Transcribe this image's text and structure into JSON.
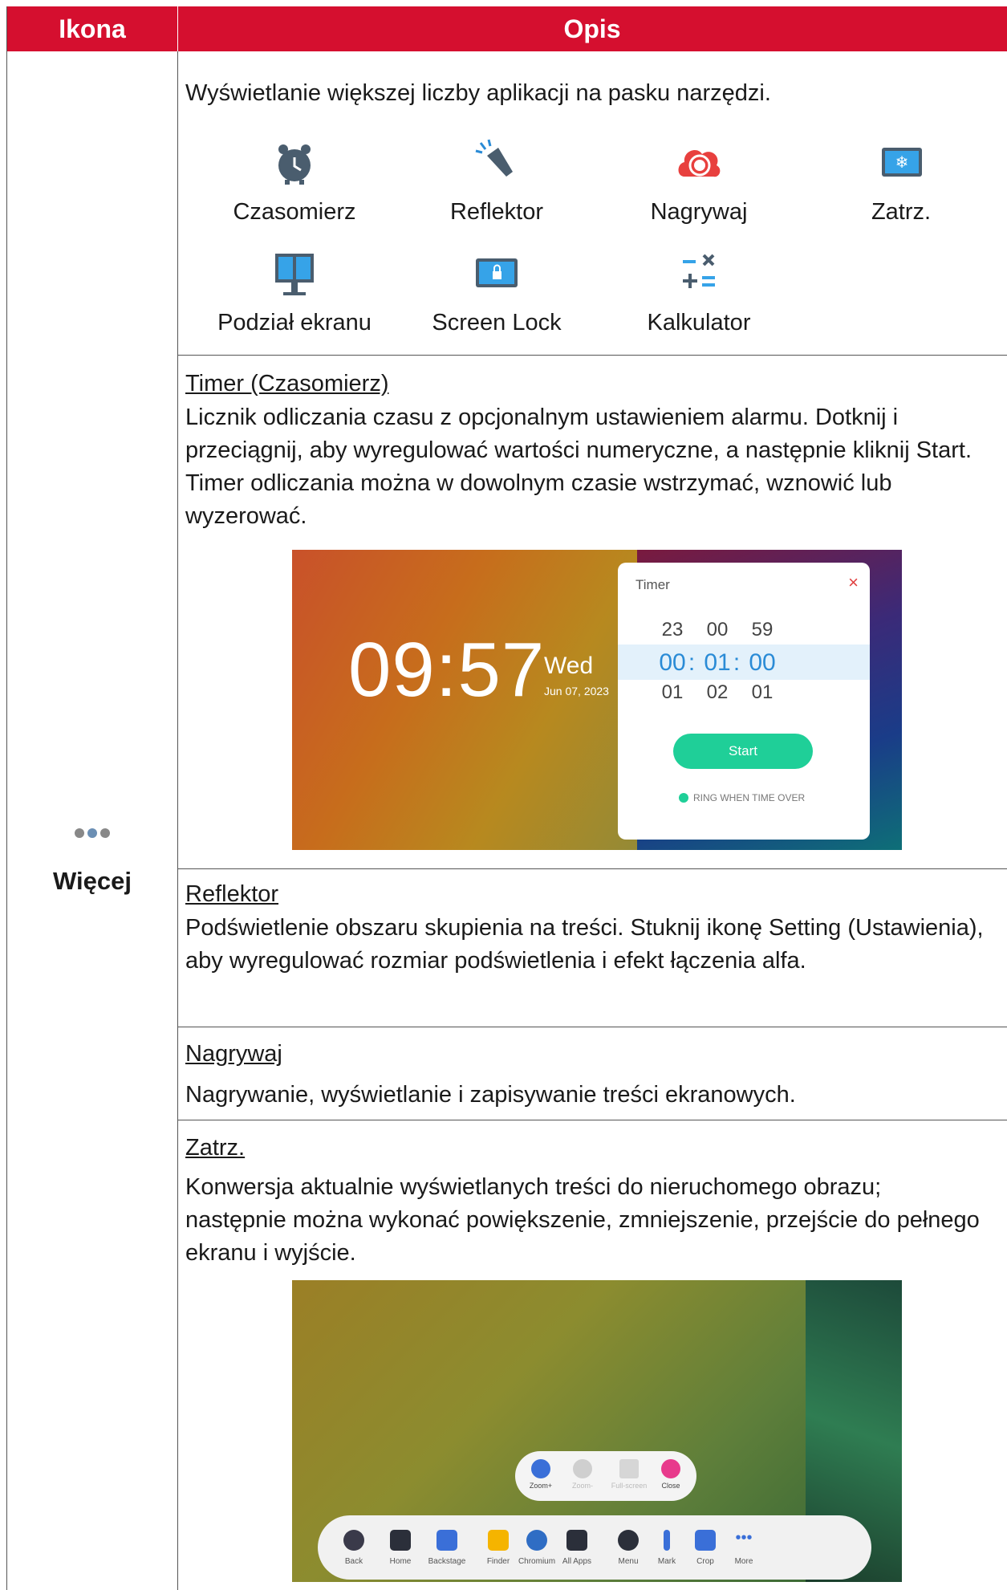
{
  "header": {
    "col1": "Ikona",
    "col2": "Opis"
  },
  "more": {
    "label": "Więcej"
  },
  "intro": "Wyświetlanie większej liczby aplikacji na pasku narzędzi.",
  "apps": [
    "Czasomierz",
    "Reflektor",
    "Nagrywaj",
    "Zatrz.",
    "Podział ekranu",
    "Screen Lock",
    "Kalkulator"
  ],
  "timer_section": {
    "title": "Timer (Czasomierz)",
    "body": "Licznik odliczania czasu z opcjonalnym ustawieniem alarmu. Dotknij i przeciągnij, aby wyregulować wartości numeryczne, a następnie kliknij Start. Timer odliczania można w dowolnym czasie wstrzymać, wznowić lub wyzerować."
  },
  "timer_shot": {
    "clock": "09:57",
    "day": "Wed",
    "date": "Jun 07, 2023",
    "dialog_title": "Timer",
    "top_row": [
      "23",
      "00",
      "59"
    ],
    "sel_row": [
      "00",
      "01",
      "00"
    ],
    "bottom_row": [
      "01",
      "02",
      "01"
    ],
    "start": "Start",
    "ring": "RING WHEN TIME OVER"
  },
  "reflektor_section": {
    "title": "Reflektor",
    "body": "Podświetlenie obszaru skupienia na treści. Stuknij ikonę Setting (Ustawienia), aby wyregulować rozmiar podświetlenia i efekt łączenia alfa."
  },
  "nagrywaj_section": {
    "title": "Nagrywaj",
    "body": "Nagrywanie, wyświetlanie i zapisywanie treści ekranowych."
  },
  "zatrz_section": {
    "title": "Zatrz.",
    "body": "Konwersja aktualnie wyświetlanych treści do nieruchomego obrazu; następnie można wykonać powiększenie, zmniejszenie, przejście do pełnego ekranu i wyjście."
  },
  "zoom_bar": [
    "Zoom+",
    "Zoom-",
    "Full-screen",
    "Close"
  ],
  "toolbar": [
    "Back",
    "Home",
    "Backstage",
    "Finder",
    "Chromium",
    "All Apps",
    "Menu",
    "Mark",
    "Crop",
    "More"
  ],
  "colors": {
    "header": "#d50f2f",
    "icon_blue": "#4a5d6e",
    "accent": "#2a8bd6",
    "start": "#1fcf98",
    "record": "#e8403e"
  }
}
